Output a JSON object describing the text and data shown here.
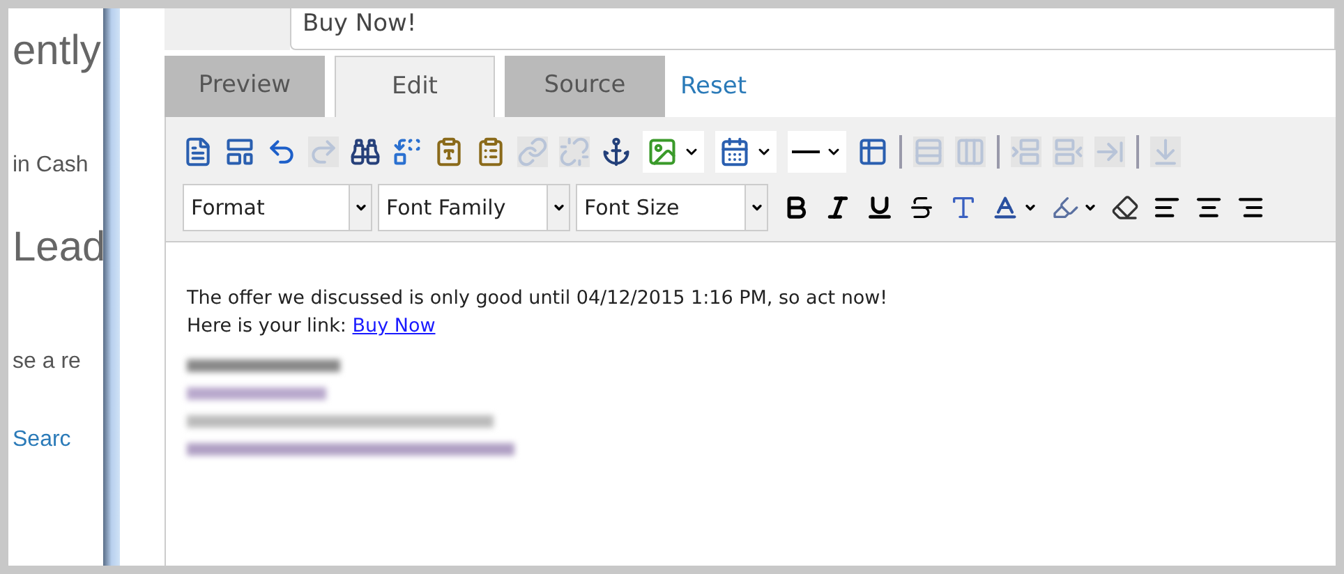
{
  "background_page": {
    "texts": [
      {
        "kind": "heading",
        "text": "ently"
      },
      {
        "kind": "label",
        "text": "in Cash"
      },
      {
        "kind": "heading",
        "text": "Lead"
      },
      {
        "kind": "label",
        "text": "se a re"
      },
      {
        "kind": "link",
        "text": "Searc"
      }
    ]
  },
  "subject": {
    "value": "Buy Now!"
  },
  "tabs": [
    {
      "label": "Preview",
      "selected": false
    },
    {
      "label": "Edit",
      "selected": true
    },
    {
      "label": "Source",
      "selected": false
    }
  ],
  "reset_link": "Reset",
  "toolbar_row_1": [
    {
      "kind": "source",
      "disabled": false
    },
    {
      "kind": "template",
      "disabled": false
    },
    {
      "kind": "undo",
      "disabled": false
    },
    {
      "kind": "redo",
      "disabled": true
    },
    {
      "kind": "find",
      "disabled": false
    },
    {
      "kind": "replace",
      "disabled": false
    },
    {
      "kind": "paste-text",
      "disabled": false
    },
    {
      "kind": "paste-word",
      "disabled": false
    },
    {
      "kind": "link",
      "disabled": true
    },
    {
      "kind": "unlink",
      "disabled": true
    },
    {
      "kind": "anchor",
      "disabled": false
    },
    {
      "kind": "image",
      "disabled": false
    },
    {
      "kind": "special-char",
      "disabled": false
    },
    {
      "kind": "rule",
      "disabled": false
    },
    {
      "kind": "table",
      "disabled": false
    },
    {
      "kind": "separator"
    },
    {
      "kind": "table-rows",
      "disabled": true
    },
    {
      "kind": "table-cols",
      "disabled": true
    },
    {
      "kind": "separator"
    },
    {
      "kind": "row-before",
      "disabled": true
    },
    {
      "kind": "row-after",
      "disabled": true
    },
    {
      "kind": "row-delete",
      "disabled": true
    },
    {
      "kind": "separator"
    },
    {
      "kind": "col-insert",
      "disabled": true
    }
  ],
  "format_selects": [
    {
      "placeholder": "Format"
    },
    {
      "placeholder": "Font Family"
    },
    {
      "placeholder": "Font Size"
    }
  ],
  "toolbar_row_2": [
    {
      "kind": "bold"
    },
    {
      "kind": "italic"
    },
    {
      "kind": "underline"
    },
    {
      "kind": "strike"
    },
    {
      "kind": "style"
    },
    {
      "kind": "fore-color"
    },
    {
      "kind": "back-color"
    },
    {
      "kind": "eraser"
    },
    {
      "kind": "align-left"
    },
    {
      "kind": "align-center"
    },
    {
      "kind": "align-right"
    }
  ],
  "body": {
    "line_1": "The offer we discussed is only good until 04/12/2015 1:16 PM, so act now!",
    "line_2": "Here is your link: ",
    "link": "Buy Now"
  }
}
